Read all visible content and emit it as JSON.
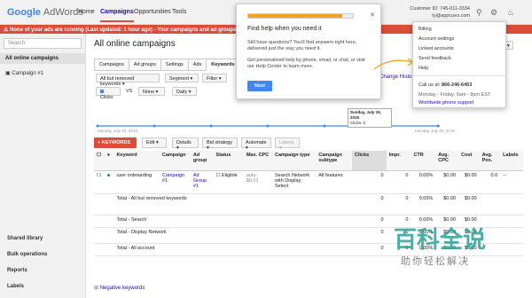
{
  "topbar": {
    "logo_google": "Google",
    "logo_product": "AdWords",
    "nav": [
      "Home",
      "Campaigns",
      "Opportunities",
      "Tools"
    ],
    "customer_id": "Customer ID: 745-011-3334",
    "customer_email": "ty@appcues.com"
  },
  "alert": {
    "text": "None of your ads are running (Last updated: 1 hour ago) - Your campaigns and ad groups are pa"
  },
  "sidebar": {
    "search_placeholder": "Search",
    "all_campaigns": "All online campaigns",
    "campaign": "Campaign #1",
    "links": [
      "Shared library",
      "Bulk operations",
      "Reports",
      "Labels"
    ]
  },
  "main": {
    "title": "All online campaigns",
    "tabs": [
      "Campaigns",
      "Ad groups",
      "Settings",
      "Ads",
      "Keywords"
    ],
    "filters": {
      "status": "All but removed keywords",
      "segment": "Segment",
      "filter": "Filter",
      "metric1": "Clicks",
      "vs": "VS",
      "metric2": "None",
      "period": "Daily"
    },
    "change_history": "Change Histo",
    "chart": {
      "start_label": "Monday, July 13, 2015",
      "end_label": "Monday, July 20, 2015",
      "tooltip_date": "Sunday, July 19, 2015",
      "tooltip_value": "Clicks: 0"
    },
    "actions": {
      "keywords": "+ KEYWORDS",
      "edit": "Edit",
      "details": "Details",
      "bid_strategy": "Bid strategy",
      "automate": "Automate",
      "labels": "Labels"
    },
    "table": {
      "headers": [
        "",
        "",
        "Keyword",
        "Campaign",
        "Ad group",
        "Status",
        "Max. CPC",
        "Campaign type",
        "Campaign subtype",
        "Clicks",
        "Impr.",
        "CTR",
        "Avg. CPC",
        "Cost",
        "Avg. Pos.",
        "Labels"
      ],
      "row": {
        "keyword": "user onboarding",
        "campaign": "Campaign #1",
        "ad_group": "Ad Group #1",
        "status": "Eligible",
        "max_cpc": "auto: $0.01",
        "campaign_type": "Search Network with Display Select",
        "campaign_subtype": "All features",
        "clicks": "0",
        "impr": "0",
        "ctr": "0.00%",
        "avg_cpc": "$0.00",
        "cost": "$0.00",
        "avg_pos": "0.0",
        "labels": "--"
      },
      "totals": [
        {
          "label": "Total - All but removed keywords",
          "clicks": "0",
          "impr": "0",
          "ctr": "0.00%",
          "avg_cpc": "$0.00",
          "cost": "$0.00"
        },
        {
          "label": "Total - Search",
          "clicks": "0",
          "impr": "0",
          "ctr": "0.00%",
          "avg_cpc": "$0.00",
          "cost": "$0.00"
        },
        {
          "label": "Total - Display Network",
          "clicks": "0",
          "impr": "0",
          "ctr": "0.00%",
          "avg_cpc": "$0.00",
          "cost": "$0.00"
        },
        {
          "label": "Total - All account",
          "clicks": "0",
          "impr": "0",
          "ctr": "0.00%",
          "avg_cpc": "$0.00",
          "cost": "$0.00"
        }
      ]
    },
    "negative_keywords": "Negative keywords"
  },
  "popup": {
    "progress": 0.9,
    "title": "Find help when you need it",
    "p1": "Still have questions? You'll find answers right here, delivered just the way you need it.",
    "p2": "Get personalized help by phone, email, or chat, or visit our Help Center to learn more.",
    "next": "Next"
  },
  "helpmenu": {
    "items": [
      "Billing",
      "Account settings",
      "Linked accounts",
      "Send feedback",
      "Help"
    ],
    "call_label": "Call us at:",
    "phone": "866-246-6453",
    "hours": "Monday - Friday: 9am - 8pm EST",
    "support_link": "Worldwide phone support"
  },
  "watermark": {
    "main": "百科全说",
    "sub": "助你轻松解决"
  },
  "colors": {
    "brand_red": "#dd4b39",
    "link_blue": "#1a0dab",
    "chart_blue": "#4285f4",
    "progress_orange": "#f4a51e"
  }
}
